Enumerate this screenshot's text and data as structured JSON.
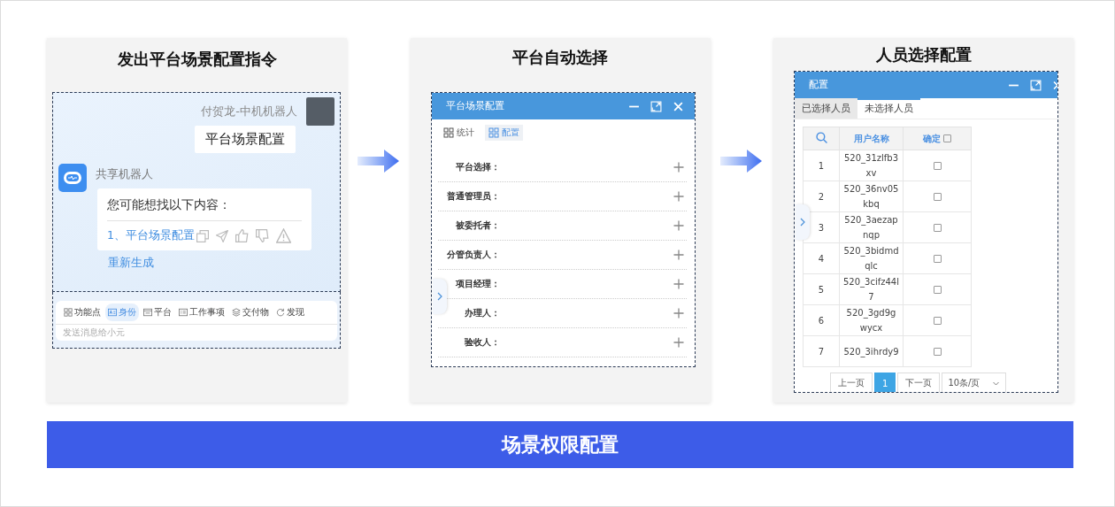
{
  "chat_panel": {
    "title": "发出平台场景配置指令",
    "user_name": "付贺龙-中机机器人",
    "user_message": "平台场景配置",
    "bot_name": "共享机器人",
    "bot_reply": {
      "intro": "您可能想找以下内容：",
      "link": "1、平台场景配置"
    },
    "regenerate": "重新生成",
    "toolbar": [
      {
        "label": "功能点",
        "selected": false
      },
      {
        "label": "身份",
        "selected": true
      },
      {
        "label": "平台",
        "selected": false
      },
      {
        "label": "工作事项",
        "selected": false
      },
      {
        "label": "交付物",
        "selected": false
      },
      {
        "label": "发现",
        "selected": false
      }
    ],
    "input": {
      "placeholder": "发送消息给小元"
    }
  },
  "config_panel": {
    "title": "平台自动选择",
    "dialog_title": "平台场景配置",
    "tabs": [
      {
        "label": "统计",
        "selected": false
      },
      {
        "label": "配置",
        "selected": true
      }
    ],
    "fields": [
      {
        "label": "平台选择："
      },
      {
        "label": "普通管理员："
      },
      {
        "label": "被委托者："
      },
      {
        "label": "分管负责人："
      },
      {
        "label": "项目经理："
      },
      {
        "label": "办理人："
      },
      {
        "label": "验收人："
      }
    ]
  },
  "people_panel": {
    "title": "人员选择配置",
    "dialog_title": "配置",
    "tabs": [
      {
        "label": "已选择人员",
        "selected": false
      },
      {
        "label": "未选择人员",
        "selected": true
      }
    ],
    "columns": [
      "用户名称",
      "确定"
    ],
    "header_checked": false,
    "rows": [
      {
        "index": "1",
        "name": "520_31zlfb3xv",
        "checked": false
      },
      {
        "index": "2",
        "name": "520_36nv05kbq",
        "checked": false
      },
      {
        "index": "3",
        "name": "520_3aezapnqp",
        "checked": false
      },
      {
        "index": "4",
        "name": "520_3bidmdqlc",
        "checked": false
      },
      {
        "index": "5",
        "name": "520_3cifz44l7",
        "checked": false
      },
      {
        "index": "6",
        "name": "520_3gd9gwycx",
        "checked": false
      },
      {
        "index": "7",
        "name": "520_3ihrdy9",
        "checked": false
      }
    ],
    "pagination": {
      "prev": "上一页",
      "pages": [
        {
          "label": "1",
          "selected": true
        }
      ],
      "next": "下一页",
      "page_size": "10条/页"
    }
  },
  "banner": {
    "title": "场景权限配置"
  }
}
